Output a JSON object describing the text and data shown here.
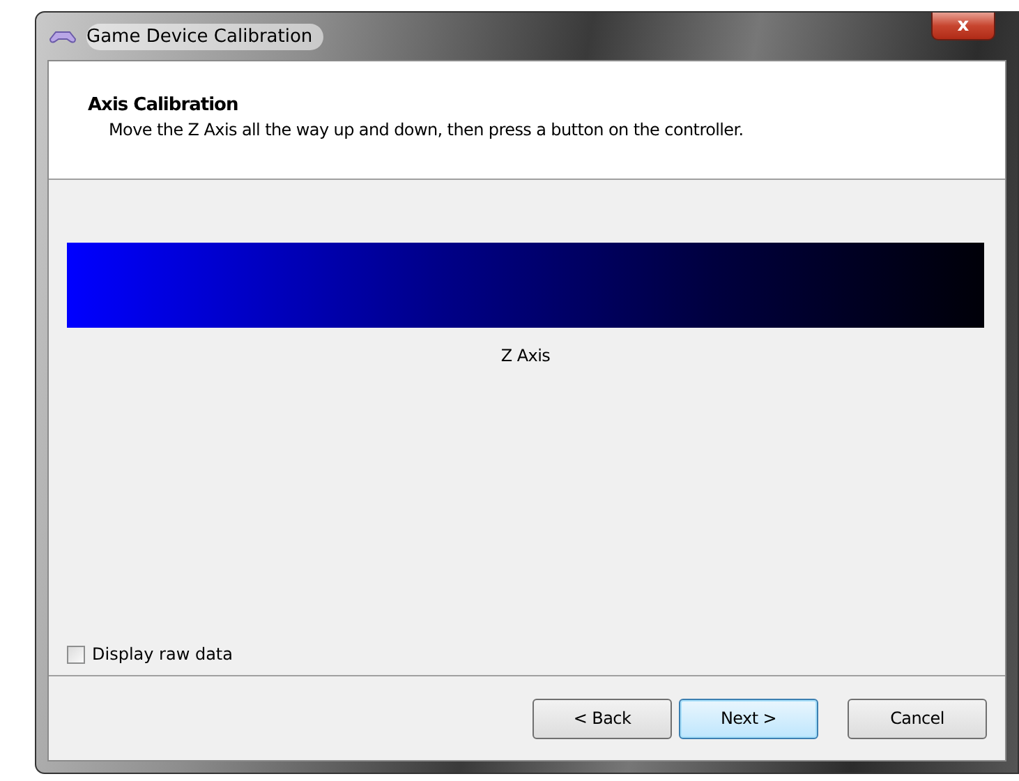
{
  "window": {
    "title": "Game Device Calibration",
    "close": "x"
  },
  "header": {
    "title": "Axis Calibration",
    "instruction": "Move the Z Axis all the way up and down, then press a button on the controller."
  },
  "axis": {
    "label": "Z Axis"
  },
  "raw_data": {
    "label": "Display raw data",
    "checked": false
  },
  "buttons": [
    {
      "label": "< Back",
      "selected": false
    },
    {
      "label": "Next >",
      "selected": true
    },
    {
      "label": "Cancel",
      "selected": false
    }
  ]
}
